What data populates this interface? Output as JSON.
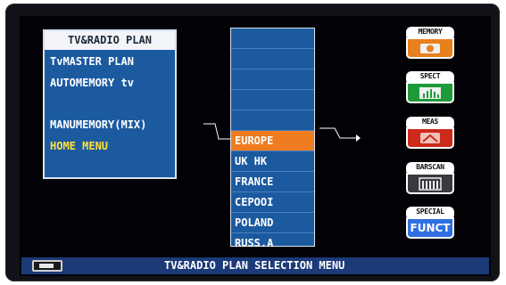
{
  "menu": {
    "title": "TV&RADIO PLAN",
    "items": [
      "TvMASTER PLAN",
      "AUTOMEMORY tv",
      "MANUMEMORY(MIX)",
      "HOME MENU"
    ]
  },
  "plan_list": {
    "items": [
      "",
      "",
      "",
      "",
      "EUROPE",
      "UK HK",
      "FRANCE",
      "CEPOOI",
      "POLAND",
      "RUSS.A"
    ],
    "selected": "EUROPE"
  },
  "side_buttons": [
    {
      "label": "MEMORY",
      "icon": "memory-icon"
    },
    {
      "label": "SPECT",
      "icon": "spectrum-icon"
    },
    {
      "label": "MEAS",
      "icon": "measure-icon"
    },
    {
      "label": "BARSCAN",
      "icon": "barscan-icon"
    },
    {
      "label": "SPECIAL",
      "body": "FUNCT"
    }
  ],
  "status": {
    "text": "TV&RADIO PLAN SELECTION MENU",
    "icon": "battery-icon"
  },
  "colors": {
    "panel_blue": "#1c5aa0",
    "selected_orange": "#f07c20",
    "home_yellow": "#ffe040",
    "status_bar": "#1c3a78"
  }
}
